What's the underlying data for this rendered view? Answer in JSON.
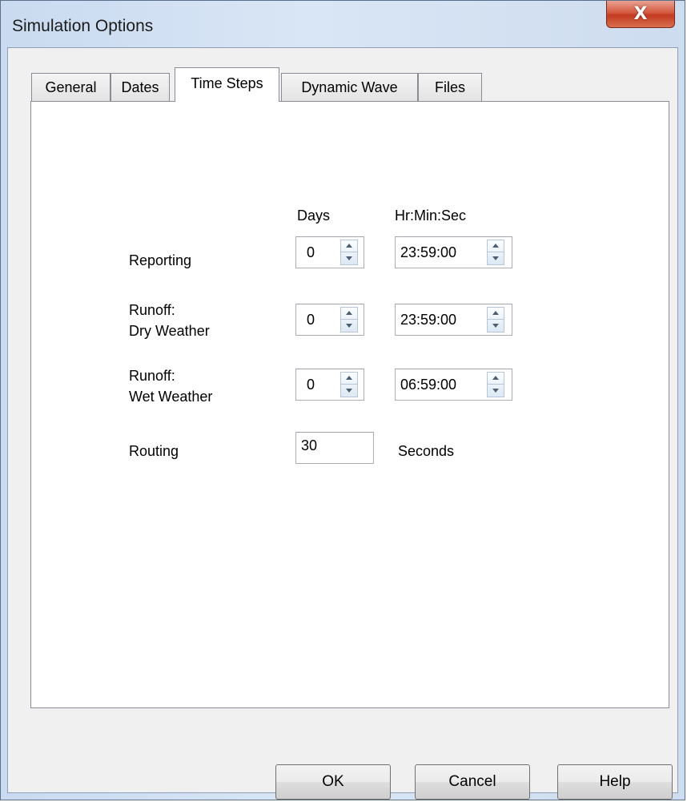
{
  "window": {
    "title": "Simulation Options",
    "close_label": "X"
  },
  "tabs": [
    {
      "label": "General"
    },
    {
      "label": "Dates"
    },
    {
      "label": "Time Steps"
    },
    {
      "label": "Dynamic Wave"
    },
    {
      "label": "Files"
    }
  ],
  "active_tab": "Time Steps",
  "time_steps": {
    "column_days": "Days",
    "column_time": "Hr:Min:Sec",
    "reporting": {
      "label": "Reporting",
      "days": "0",
      "time": "23:59:00"
    },
    "runoff_dry": {
      "label_line1": "Runoff:",
      "label_line2": "Dry Weather",
      "days": "0",
      "time": "23:59:00"
    },
    "runoff_wet": {
      "label_line1": "Runoff:",
      "label_line2": "Wet Weather",
      "days": "0",
      "time": "06:59:00"
    },
    "routing": {
      "label": "Routing",
      "value": "30",
      "unit": "Seconds"
    }
  },
  "buttons": {
    "ok": "OK",
    "cancel": "Cancel",
    "help": "Help"
  }
}
